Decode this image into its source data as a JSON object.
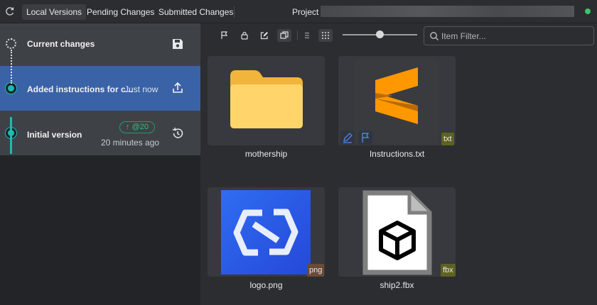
{
  "tabs": [
    {
      "label": "Local Versions",
      "active": true
    },
    {
      "label": "Pending Changes",
      "active": false
    },
    {
      "label": "Submitted Changes",
      "active": false
    }
  ],
  "project_label": "Project",
  "history": {
    "current": {
      "title": "Current changes"
    },
    "selected": {
      "title": "Added instructions for c...",
      "time": "Just now"
    },
    "initial": {
      "title": "Initial version",
      "badge": "@20",
      "time": "20 minutes ago"
    }
  },
  "filter": {
    "placeholder": "Item Filter..."
  },
  "zoom_level": 0.5,
  "files": [
    {
      "name": "mothership",
      "type": "folder",
      "ext": ""
    },
    {
      "name": "Instructions.txt",
      "type": "sublime",
      "ext": "txt"
    },
    {
      "name": "logo.png",
      "type": "image",
      "ext": "png"
    },
    {
      "name": "ship2.fbx",
      "type": "model",
      "ext": "fbx"
    }
  ],
  "colors": {
    "accent": "#3a62a7",
    "node": "#1fb9b0",
    "badge": "#2cc279",
    "status": "#3cc46b"
  }
}
